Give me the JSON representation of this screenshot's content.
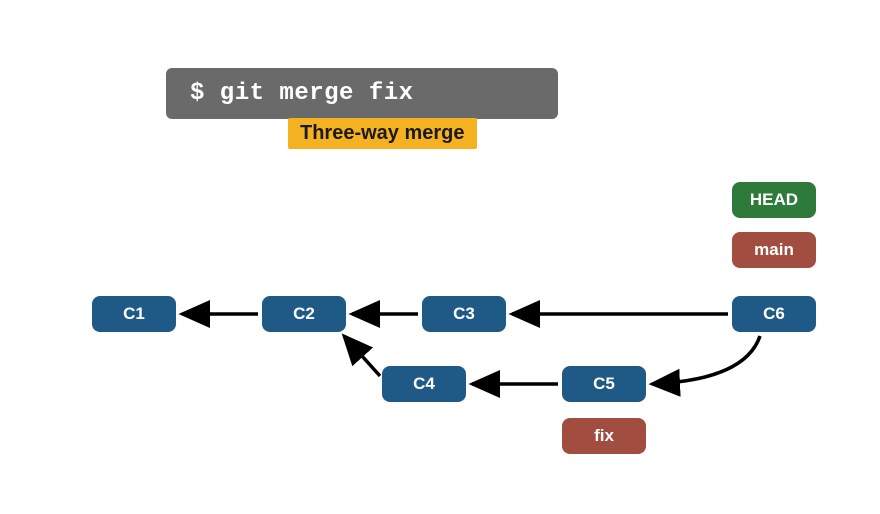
{
  "terminal": {
    "command": "$ git merge fix"
  },
  "label": {
    "merge_type": "Three-way merge"
  },
  "refs": {
    "head": "HEAD",
    "main": "main",
    "fix": "fix"
  },
  "commits": {
    "c1": "C1",
    "c2": "C2",
    "c3": "C3",
    "c4": "C4",
    "c5": "C5",
    "c6": "C6"
  },
  "chart_data": {
    "type": "graph",
    "title": "Three-way merge",
    "command": "$ git merge fix",
    "nodes": [
      {
        "id": "C1",
        "kind": "commit"
      },
      {
        "id": "C2",
        "kind": "commit"
      },
      {
        "id": "C3",
        "kind": "commit"
      },
      {
        "id": "C4",
        "kind": "commit"
      },
      {
        "id": "C5",
        "kind": "commit"
      },
      {
        "id": "C6",
        "kind": "commit",
        "is_merge": true
      },
      {
        "id": "HEAD",
        "kind": "head_ref",
        "points_to": "main"
      },
      {
        "id": "main",
        "kind": "branch",
        "points_to": "C6"
      },
      {
        "id": "fix",
        "kind": "branch",
        "points_to": "C5"
      }
    ],
    "edges": [
      {
        "from": "C2",
        "to": "C1",
        "meaning": "parent"
      },
      {
        "from": "C3",
        "to": "C2",
        "meaning": "parent"
      },
      {
        "from": "C4",
        "to": "C2",
        "meaning": "parent"
      },
      {
        "from": "C5",
        "to": "C4",
        "meaning": "parent"
      },
      {
        "from": "C6",
        "to": "C3",
        "meaning": "parent"
      },
      {
        "from": "C6",
        "to": "C5",
        "meaning": "parent"
      }
    ],
    "merge_base": "C2",
    "merge_result": "C6",
    "merge_parents": [
      "C3",
      "C5"
    ]
  }
}
